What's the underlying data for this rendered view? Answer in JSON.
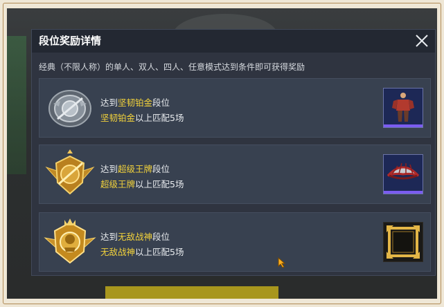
{
  "dialog": {
    "title": "段位奖励详情",
    "subtitle": "经典（不限人称）的单人、双人、四人、任意模式达到条件即可获得奖励"
  },
  "rows": [
    {
      "reach_prefix": "达到",
      "tier": "坚韧铂金",
      "reach_suffix": "段位",
      "condition_tier": "坚韧铂金",
      "condition_text": "以上匹配",
      "count": "5场",
      "badge_icon": "platinum-badge-icon",
      "reward_icon": "outfit-reward-icon"
    },
    {
      "reach_prefix": "达到",
      "tier": "超级王牌",
      "reach_suffix": "段位",
      "condition_tier": "超级王牌",
      "condition_text": "以上匹配",
      "count": "5场",
      "badge_icon": "ace-badge-icon",
      "reward_icon": "parachute-reward-icon"
    },
    {
      "reach_prefix": "达到",
      "tier": "无敌战神",
      "reach_suffix": "段位",
      "condition_tier": "无敌战神",
      "condition_text": "以上匹配",
      "count": "5场",
      "badge_icon": "conqueror-badge-icon",
      "reward_icon": "avatar-frame-reward-icon"
    }
  ],
  "colors": {
    "highlight": "#f2d23b",
    "row_bg": "#384150",
    "reward_accent": "#7b5cf0"
  }
}
